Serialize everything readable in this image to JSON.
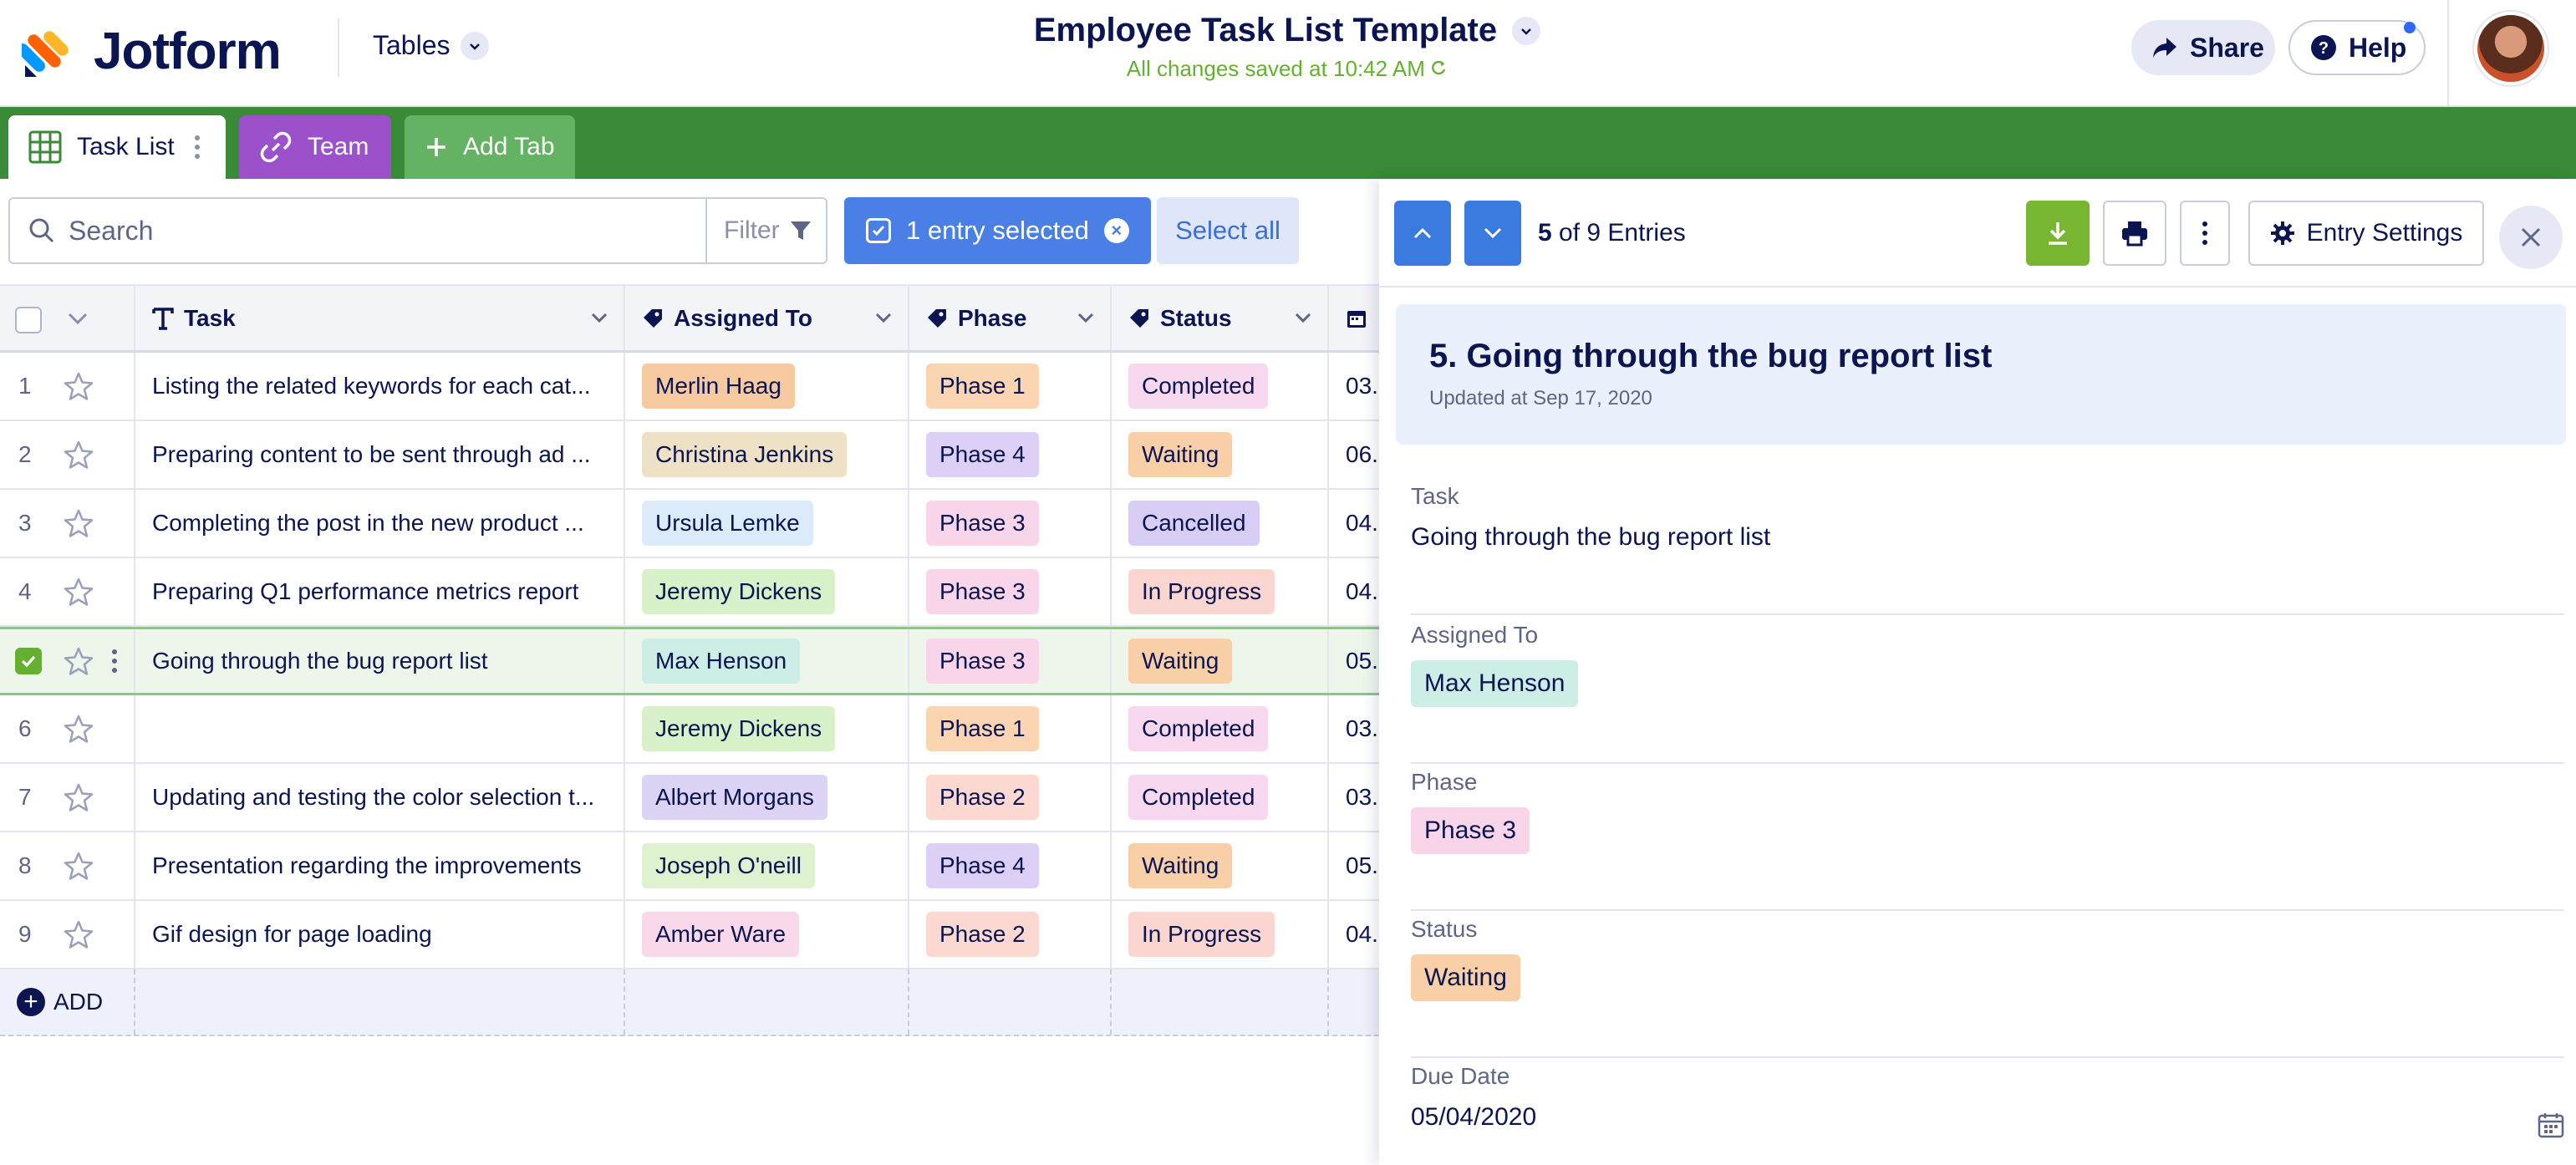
{
  "header": {
    "brand": "Jotform",
    "tables_label": "Tables",
    "doc_title": "Employee Task List Template",
    "save_status": "All changes saved at 10:42 AM",
    "share_label": "Share",
    "help_label": "Help"
  },
  "tabs": [
    {
      "label": "Task List",
      "icon": "grid-icon"
    },
    {
      "label": "Team",
      "icon": "link-icon"
    },
    {
      "label": "Add Tab",
      "icon": "plus-icon"
    }
  ],
  "toolbar": {
    "search_placeholder": "Search",
    "filter_label": "Filter",
    "selected_label": "1 entry selected",
    "select_all_label": "Select all"
  },
  "table": {
    "columns": [
      "Task",
      "Assigned To",
      "Phase",
      "Status"
    ],
    "rows": [
      {
        "num": "1",
        "task": "Listing the related keywords for each cat...",
        "assigned": "Merlin Haag",
        "phase": "Phase 1",
        "status": "Completed",
        "date": "03."
      },
      {
        "num": "2",
        "task": "Preparing content to be sent through ad ...",
        "assigned": "Christina Jenkins",
        "phase": "Phase 4",
        "status": "Waiting",
        "date": "06."
      },
      {
        "num": "3",
        "task": "Completing the post in the new product ...",
        "assigned": "Ursula Lemke",
        "phase": "Phase 3",
        "status": "Cancelled",
        "date": "04."
      },
      {
        "num": "4",
        "task": "Preparing Q1 performance metrics report",
        "assigned": "Jeremy Dickens",
        "phase": "Phase 3",
        "status": "In Progress",
        "date": "04."
      },
      {
        "num": "5",
        "task": "Going through the bug report list",
        "assigned": "Max Henson",
        "phase": "Phase 3",
        "status": "Waiting",
        "date": "05."
      },
      {
        "num": "6",
        "task": "",
        "assigned": "Jeremy Dickens",
        "phase": "Phase 1",
        "status": "Completed",
        "date": "03."
      },
      {
        "num": "7",
        "task": "Updating and testing the color selection t...",
        "assigned": "Albert Morgans",
        "phase": "Phase 2",
        "status": "Completed",
        "date": "03."
      },
      {
        "num": "8",
        "task": "Presentation regarding the improvements",
        "assigned": "Joseph O'neill",
        "phase": "Phase 4",
        "status": "Waiting",
        "date": "05."
      },
      {
        "num": "9",
        "task": "Gif design for page loading",
        "assigned": "Amber Ware",
        "phase": "Phase 2",
        "status": "In Progress",
        "date": "04."
      }
    ],
    "add_label": "ADD"
  },
  "colors": {
    "assigned": {
      "Merlin Haag": "#f6c9a1",
      "Christina Jenkins": "#efe1c5",
      "Ursula Lemke": "#dcebfa",
      "Jeremy Dickens": "#d9f1c9",
      "Max Henson": "#cdeee6",
      "Albert Morgans": "#ddd3f5",
      "Joseph O'neill": "#dff2cf",
      "Amber Ware": "#f9d8ea"
    },
    "phase": {
      "Phase 1": "#fbd4b2",
      "Phase 2": "#fbd8d0",
      "Phase 3": "#f9d5ea",
      "Phase 4": "#ddd0f6"
    },
    "status": {
      "Completed": "#f7d8ee",
      "Waiting": "#f8cfa6",
      "Cancelled": "#d8cdf4",
      "In Progress": "#fbd5cf"
    },
    "tabbar": "#3a8a37",
    "accent_blue": "#3b7be0"
  },
  "panel": {
    "entry_index": "5",
    "entry_total_text": "of 9 Entries",
    "settings_label": "Entry Settings",
    "title": "5. Going through the bug report list",
    "updated": "Updated at Sep 17, 2020",
    "fields": {
      "task_label": "Task",
      "task_value": "Going through the bug report list",
      "assigned_label": "Assigned To",
      "assigned_value": "Max Henson",
      "phase_label": "Phase",
      "phase_value": "Phase 3",
      "status_label": "Status",
      "status_value": "Waiting",
      "due_label": "Due Date",
      "due_value": "05/04/2020"
    }
  }
}
